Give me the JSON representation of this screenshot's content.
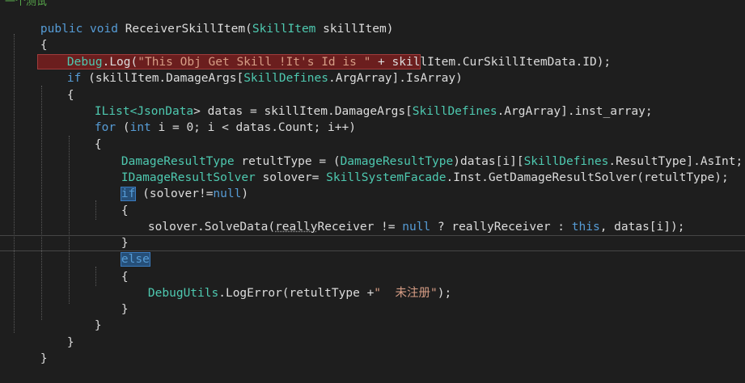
{
  "editor": {
    "top_cut": "一个测试",
    "lines": {
      "l1": {
        "a": "public",
        "b": " void ",
        "c": "ReceiverSkillItem(",
        "d": "SkillItem",
        "e": " skillItem)"
      },
      "l2": {
        "a": "{"
      },
      "l3": {
        "a": "Debug",
        ".": ".",
        "b": "Log(",
        "c": "\"This Obj Get Skill !It's Id is \"",
        "d": " + skillItem.",
        "e": "CurSkillItemData.ID);"
      },
      "l4": {
        "a": "if",
        "b": " (skillItem.",
        "c": "DamageArgs[",
        "d": "SkillDefines",
        ".": ".",
        "e": "ArgArray].",
        "f": "IsArray)"
      },
      "l5": {
        "a": "{"
      },
      "l6": {
        "a": "IList<",
        "b": "JsonData",
        "c": "> datas = skillItem.",
        "d": "DamageArgs[",
        "e": "SkillDefines",
        ".": ".",
        "f": "ArgArray].inst_array;"
      },
      "l7": {
        "a": "for",
        "b": " (",
        "c": "int",
        "d": " i = 0; i < datas.Count; i++)"
      },
      "l8": {
        "a": "{"
      },
      "l9": {
        "a": "DamageResultType",
        "b": " retultType = (",
        "c": "DamageResultType",
        "d": ")datas[i][",
        "e": "SkillDefines",
        ".": ".",
        "f": "ResultType].AsInt;"
      },
      "l10": {
        "a": "IDamageResultSolver",
        "b": " solover= ",
        "c": "SkillSystemFacade",
        ".": ".",
        "d": "Inst.GetDamageResultSolver(retultType);"
      },
      "l11": {
        "a": "if",
        "b": " (solover!=",
        "c": "null",
        ")": ")"
      },
      "l12": {
        "a": "{"
      },
      "l13": {
        "a": "solover.",
        "b": "SolveData(",
        "c": "really",
        "d": "Receiver != ",
        "e": "null",
        "f": " ? reallyReceiver : ",
        "g": "this",
        ",": ", datas[i]);"
      },
      "l14": {
        "a": "}"
      },
      "l15": {
        "a": "else"
      },
      "l16": {
        "a": "{"
      },
      "l17": {
        "a": "DebugUtils",
        ".": ".",
        "b": "LogError(retultType +",
        "c": "\"  未注册\"",
        ");": ");"
      },
      "l18": {
        "a": "}"
      },
      "l19": {
        "a": "}"
      },
      "l20": {
        "a": "}"
      },
      "l21": {
        "a": "}"
      }
    }
  },
  "colors": {
    "background": "#1e1e1e",
    "keyword": "#569cd6",
    "type": "#4ec9b0",
    "string": "#d69d85",
    "default": "#dcdcdc",
    "highlight": "#6b1e1e",
    "selection": "#264f78"
  }
}
